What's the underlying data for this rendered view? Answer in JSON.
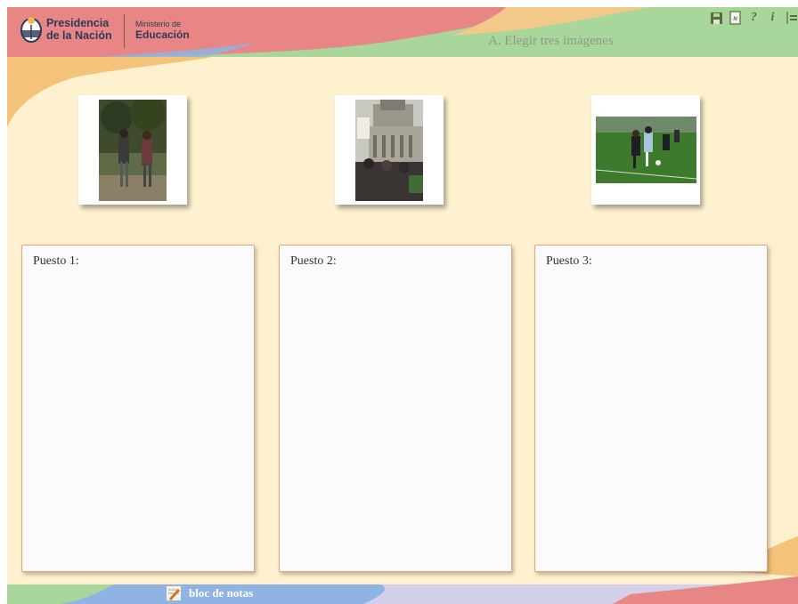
{
  "header": {
    "presidency_line1": "Presidencia",
    "presidency_line2": "de la Nación",
    "ministry_line1": "Ministerio de",
    "ministry_line2": "Educación",
    "title": "A. Elegir tres imágenes"
  },
  "toolbar": {
    "save_icon": "save-icon",
    "notepad_icon": "notepad-icon",
    "help_label": "?",
    "info_label": "i",
    "menu_icon": "menu-icon"
  },
  "images": [
    {
      "description_icon": "hikers-photo"
    },
    {
      "description_icon": "protest-photo"
    },
    {
      "description_icon": "soccer-photo"
    }
  ],
  "slots": [
    {
      "label": "Puesto 1:"
    },
    {
      "label": "Puesto 2:"
    },
    {
      "label": "Puesto 3:"
    }
  ],
  "footer": {
    "notes_label": "bloc de notas"
  },
  "colors": {
    "background": "#fdf1cf",
    "header_red": "#e88585",
    "header_green": "#a9d69a",
    "footer_blue": "#8fb3e3",
    "slot_border": "#e5a27b"
  }
}
